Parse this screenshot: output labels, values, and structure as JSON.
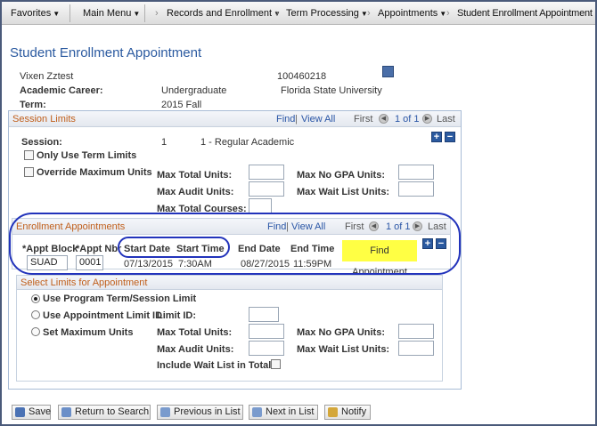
{
  "navbar": {
    "favorites": "Favorites",
    "main_menu": "Main Menu",
    "breadcrumbs": [
      "Records and Enrollment",
      "Term Processing",
      "Appointments"
    ],
    "current": "Student Enrollment Appointment"
  },
  "page_title": "Student Enrollment Appointment",
  "student": {
    "name": "Vixen Zztest",
    "id": "100460218",
    "career_label": "Academic Career:",
    "career_value": "Undergraduate",
    "institution": "Florida State University",
    "term_label": "Term:",
    "term_value": "2015 Fall"
  },
  "session_limits": {
    "title": "Session Limits",
    "find": "Find",
    "view_all": "View All",
    "first": "First",
    "count": "1 of 1",
    "last": "Last",
    "session_label": "Session:",
    "session_num": "1",
    "session_desc": "1 - Regular Academic",
    "only_term_limits": "Only Use Term Limits",
    "override_max_units": "Override Maximum Units",
    "max_total_units": "Max Total Units:",
    "max_no_gpa_units": "Max No GPA Units:",
    "max_audit_units": "Max Audit Units:",
    "max_wait_list_units": "Max Wait List Units:",
    "max_total_courses": "Max Total Courses:"
  },
  "enrollment_appointments": {
    "title": "Enrollment Appointments",
    "find": "Find",
    "view_all": "View All",
    "first": "First",
    "count": "1 of 1",
    "last": "Last",
    "col_appt_block": "*Appt Block",
    "col_appt_nbr": "*Appt Nbr",
    "col_start_date": "Start Date",
    "col_start_time": "Start Time",
    "col_end_date": "End Date",
    "col_end_time": "End Time",
    "appt_block": "SUAD",
    "appt_nbr": "0001",
    "start_date": "07/13/2015",
    "start_time": "7:30AM",
    "end_date": "08/27/2015",
    "end_time": "11:59PM",
    "find_appointment": "Find Appointment"
  },
  "select_limits": {
    "title": "Select Limits for Appointment",
    "use_program": "Use Program Term/Session Limit",
    "use_limit_id": "Use Appointment Limit ID",
    "limit_id_label": "Limit ID:",
    "set_max_units": "Set Maximum Units",
    "max_total_units": "Max Total Units:",
    "max_no_gpa_units": "Max No GPA Units:",
    "max_audit_units": "Max Audit Units:",
    "max_wait_list_units": "Max Wait List Units:",
    "include_wait_list": "Include Wait List in Total:"
  },
  "toolbar": {
    "save": "Save",
    "return_to_search": "Return to Search",
    "previous_in_list": "Previous in List",
    "next_in_list": "Next in List",
    "notify": "Notify"
  }
}
